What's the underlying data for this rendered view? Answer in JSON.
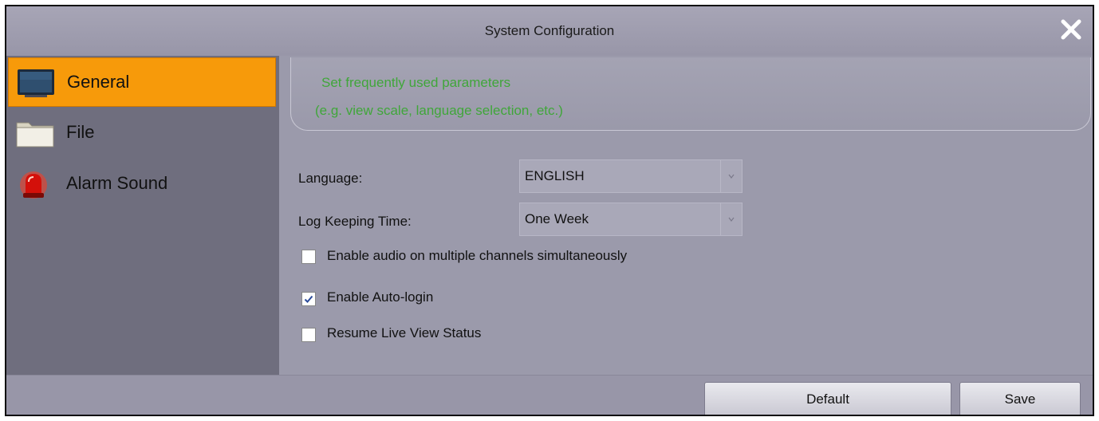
{
  "window": {
    "title": "System Configuration"
  },
  "sidebar": {
    "items": [
      {
        "label": "General",
        "icon": "monitor-icon",
        "active": true
      },
      {
        "label": "File",
        "icon": "folder-icon",
        "active": false
      },
      {
        "label": "Alarm Sound",
        "icon": "alarm-light-icon",
        "active": false
      }
    ]
  },
  "info": {
    "line1": "Set frequently used parameters",
    "line2": "(e.g. view scale, language selection, etc.)"
  },
  "form": {
    "language_label": "Language:",
    "language_value": "ENGLISH",
    "log_label": "Log Keeping Time:",
    "log_value": "One Week",
    "checkboxes": [
      {
        "label": "Enable audio on multiple channels simultaneously",
        "checked": false
      },
      {
        "label": "Enable Auto-login",
        "checked": true
      },
      {
        "label": "Resume Live View Status",
        "checked": false
      }
    ]
  },
  "footer": {
    "default_label": "Default",
    "save_label": "Save"
  },
  "colors": {
    "accent": "#f79a0a",
    "info_text": "#40a63a"
  }
}
